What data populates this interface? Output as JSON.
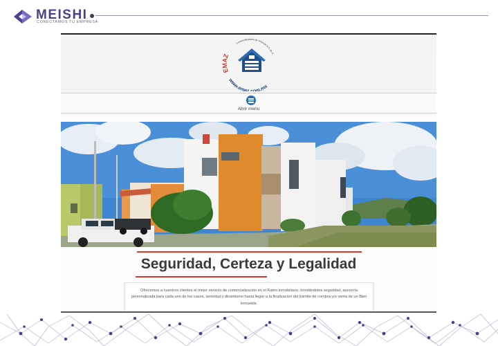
{
  "brand": {
    "name": "MEISHI",
    "tagline": "CONECTAMOS TU EMPRESA",
    "colors": {
      "primary": "#4b3d8f",
      "accent": "#d0392b",
      "menu": "#2c6fb8"
    }
  },
  "site": {
    "logo": {
      "name": "EMAZ",
      "subtitle": "Comercializadora de Vivienda S.A. de C.V.",
      "url": "www.emaz.com.mx"
    },
    "menu": {
      "label": "Abrir menu",
      "icon": "hamburger-icon"
    },
    "hero": {
      "image": "house-photo"
    },
    "title": "Seguridad, Certeza y Legalidad",
    "description": "Ofrecemos a nuestros clientes el mejor servicio de comercialización en el Ramo inmobiliario, brindándoles seguridad, asesoría personalizada para cada uno de los casos, seriedad y dinamismo hasta llegar a la finalización del trámite de compra y/o venta de un Bien Inmueble."
  }
}
